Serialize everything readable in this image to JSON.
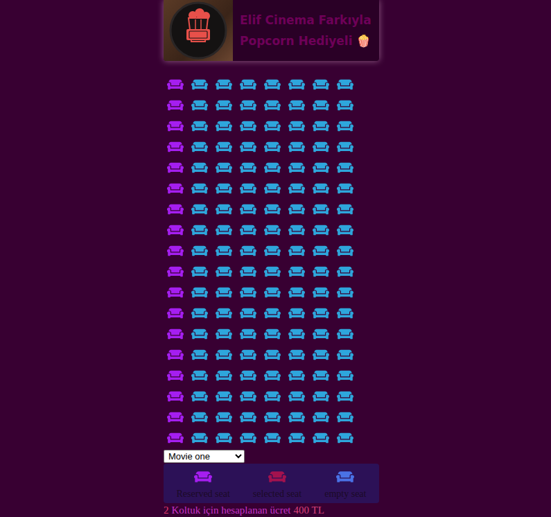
{
  "header": {
    "title_lines": [
      "Elif Cinema Farkıyla",
      "Popcorn Hediyeli 🍿"
    ]
  },
  "seat_rows": [
    {
      "seats": [
        {
          "reserved": true,
          "selected": false
        },
        {
          "reserved": false,
          "selected": false
        },
        {
          "reserved": false,
          "selected": false
        },
        {
          "reserved": false,
          "selected": false
        },
        {
          "reserved": false,
          "selected": false
        },
        {
          "reserved": false,
          "selected": false
        },
        {
          "reserved": false,
          "selected": false
        },
        {
          "reserved": false,
          "selected": false
        }
      ]
    },
    {
      "seats": [
        {
          "reserved": true,
          "selected": false
        },
        {
          "reserved": false,
          "selected": false
        },
        {
          "reserved": false,
          "selected": false
        },
        {
          "reserved": false,
          "selected": false
        },
        {
          "reserved": false,
          "selected": false
        },
        {
          "reserved": false,
          "selected": false
        },
        {
          "reserved": false,
          "selected": false
        },
        {
          "reserved": false,
          "selected": false
        }
      ]
    },
    {
      "seats": [
        {
          "reserved": true,
          "selected": false
        },
        {
          "reserved": false,
          "selected": false
        },
        {
          "reserved": false,
          "selected": false
        },
        {
          "reserved": false,
          "selected": false
        },
        {
          "reserved": false,
          "selected": false
        },
        {
          "reserved": false,
          "selected": false
        },
        {
          "reserved": false,
          "selected": false
        },
        {
          "reserved": false,
          "selected": false
        }
      ]
    },
    {
      "seats": [
        {
          "reserved": true,
          "selected": false
        },
        {
          "reserved": false,
          "selected": false
        },
        {
          "reserved": false,
          "selected": false
        },
        {
          "reserved": false,
          "selected": false
        },
        {
          "reserved": false,
          "selected": false
        },
        {
          "reserved": false,
          "selected": false
        },
        {
          "reserved": false,
          "selected": false
        },
        {
          "reserved": false,
          "selected": false
        }
      ]
    },
    {
      "seats": [
        {
          "reserved": true,
          "selected": false
        },
        {
          "reserved": false,
          "selected": false
        },
        {
          "reserved": false,
          "selected": false
        },
        {
          "reserved": false,
          "selected": false
        },
        {
          "reserved": false,
          "selected": false
        },
        {
          "reserved": false,
          "selected": false
        },
        {
          "reserved": false,
          "selected": false
        },
        {
          "reserved": false,
          "selected": false
        }
      ]
    },
    {
      "seats": [
        {
          "reserved": true,
          "selected": false
        },
        {
          "reserved": false,
          "selected": false
        },
        {
          "reserved": false,
          "selected": false
        },
        {
          "reserved": false,
          "selected": false
        },
        {
          "reserved": false,
          "selected": false
        },
        {
          "reserved": false,
          "selected": false
        },
        {
          "reserved": false,
          "selected": false
        },
        {
          "reserved": false,
          "selected": false
        }
      ]
    },
    {
      "seats": [
        {
          "reserved": true,
          "selected": false
        },
        {
          "reserved": false,
          "selected": false
        },
        {
          "reserved": false,
          "selected": false
        },
        {
          "reserved": false,
          "selected": false
        },
        {
          "reserved": false,
          "selected": false
        },
        {
          "reserved": false,
          "selected": false
        },
        {
          "reserved": false,
          "selected": false
        },
        {
          "reserved": false,
          "selected": false
        }
      ]
    },
    {
      "seats": [
        {
          "reserved": true,
          "selected": false
        },
        {
          "reserved": false,
          "selected": false
        },
        {
          "reserved": false,
          "selected": false
        },
        {
          "reserved": false,
          "selected": false
        },
        {
          "reserved": false,
          "selected": false
        },
        {
          "reserved": false,
          "selected": false
        },
        {
          "reserved": false,
          "selected": false
        },
        {
          "reserved": false,
          "selected": false
        }
      ]
    },
    {
      "seats": [
        {
          "reserved": true,
          "selected": false
        },
        {
          "reserved": false,
          "selected": false
        },
        {
          "reserved": false,
          "selected": false
        },
        {
          "reserved": false,
          "selected": false
        },
        {
          "reserved": false,
          "selected": false
        },
        {
          "reserved": false,
          "selected": false
        },
        {
          "reserved": false,
          "selected": false
        },
        {
          "reserved": false,
          "selected": false
        }
      ]
    },
    {
      "seats": [
        {
          "reserved": true,
          "selected": false
        },
        {
          "reserved": false,
          "selected": false
        },
        {
          "reserved": false,
          "selected": false
        },
        {
          "reserved": false,
          "selected": false
        },
        {
          "reserved": false,
          "selected": false
        },
        {
          "reserved": false,
          "selected": false
        },
        {
          "reserved": false,
          "selected": false
        },
        {
          "reserved": false,
          "selected": false
        }
      ]
    },
    {
      "seats": [
        {
          "reserved": true,
          "selected": false
        },
        {
          "reserved": false,
          "selected": false
        },
        {
          "reserved": false,
          "selected": false
        },
        {
          "reserved": false,
          "selected": false
        },
        {
          "reserved": false,
          "selected": false
        },
        {
          "reserved": false,
          "selected": false
        },
        {
          "reserved": false,
          "selected": false
        },
        {
          "reserved": false,
          "selected": false
        }
      ]
    },
    {
      "seats": [
        {
          "reserved": true,
          "selected": false
        },
        {
          "reserved": false,
          "selected": false
        },
        {
          "reserved": false,
          "selected": false
        },
        {
          "reserved": false,
          "selected": false
        },
        {
          "reserved": false,
          "selected": false
        },
        {
          "reserved": false,
          "selected": false
        },
        {
          "reserved": false,
          "selected": false
        },
        {
          "reserved": false,
          "selected": false
        }
      ]
    },
    {
      "seats": [
        {
          "reserved": true,
          "selected": false
        },
        {
          "reserved": false,
          "selected": false
        },
        {
          "reserved": false,
          "selected": false
        },
        {
          "reserved": false,
          "selected": false
        },
        {
          "reserved": false,
          "selected": false
        },
        {
          "reserved": false,
          "selected": false
        },
        {
          "reserved": false,
          "selected": false
        },
        {
          "reserved": false,
          "selected": false
        }
      ]
    },
    {
      "seats": [
        {
          "reserved": true,
          "selected": false
        },
        {
          "reserved": false,
          "selected": false
        },
        {
          "reserved": false,
          "selected": false
        },
        {
          "reserved": false,
          "selected": false
        },
        {
          "reserved": false,
          "selected": false
        },
        {
          "reserved": false,
          "selected": false
        },
        {
          "reserved": false,
          "selected": false
        },
        {
          "reserved": false,
          "selected": false
        }
      ]
    },
    {
      "seats": [
        {
          "reserved": true,
          "selected": false
        },
        {
          "reserved": false,
          "selected": false
        },
        {
          "reserved": false,
          "selected": false
        },
        {
          "reserved": false,
          "selected": false
        },
        {
          "reserved": false,
          "selected": false
        },
        {
          "reserved": false,
          "selected": false
        },
        {
          "reserved": false,
          "selected": false
        },
        {
          "reserved": false,
          "selected": false
        }
      ]
    },
    {
      "seats": [
        {
          "reserved": true,
          "selected": false
        },
        {
          "reserved": false,
          "selected": false
        },
        {
          "reserved": false,
          "selected": false
        },
        {
          "reserved": false,
          "selected": false
        },
        {
          "reserved": false,
          "selected": false
        },
        {
          "reserved": false,
          "selected": false
        },
        {
          "reserved": false,
          "selected": false
        },
        {
          "reserved": false,
          "selected": false
        }
      ]
    },
    {
      "seats": [
        {
          "reserved": true,
          "selected": false
        },
        {
          "reserved": false,
          "selected": false
        },
        {
          "reserved": false,
          "selected": false
        },
        {
          "reserved": false,
          "selected": false
        },
        {
          "reserved": false,
          "selected": false
        },
        {
          "reserved": false,
          "selected": false
        },
        {
          "reserved": false,
          "selected": false
        },
        {
          "reserved": false,
          "selected": false
        }
      ]
    },
    {
      "seats": [
        {
          "reserved": true,
          "selected": false
        },
        {
          "reserved": false,
          "selected": false
        },
        {
          "reserved": false,
          "selected": false
        },
        {
          "reserved": false,
          "selected": false
        },
        {
          "reserved": false,
          "selected": false
        },
        {
          "reserved": false,
          "selected": false
        },
        {
          "reserved": false,
          "selected": false
        },
        {
          "reserved": false,
          "selected": false
        }
      ]
    }
  ],
  "movie_select": {
    "value": "Movie one"
  },
  "legend": [
    {
      "label": "Reserved seat",
      "color": "#a51ef0"
    },
    {
      "label": "selected seat",
      "color": "#a3124e"
    },
    {
      "label": "empty seat",
      "color": "#4a72e6"
    }
  ],
  "summary": {
    "count": "2",
    "text": "Koltuk için hesaplanan ücret",
    "price": "400 TL"
  }
}
